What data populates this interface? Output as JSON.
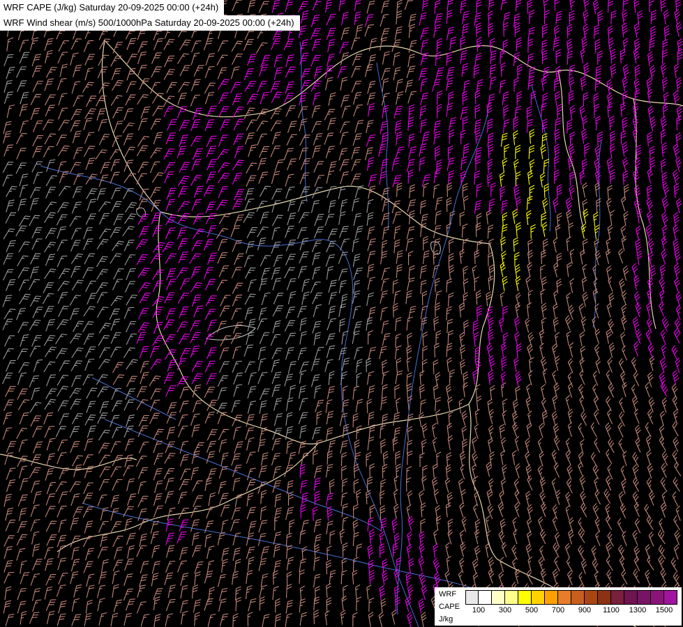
{
  "titles": {
    "line1": "WRF CAPE (J/kg) Saturday 20-09-2025 00:00 (+24h)",
    "line2": "WRF Wind shear (m/s) 500/1000hPa Saturday 20-09-2025 00:00 (+24h)"
  },
  "legend": {
    "model": "WRF",
    "variable": "CAPE",
    "units": "J/kg",
    "tick_labels": [
      "100",
      "300",
      "500",
      "700",
      "900",
      "1100",
      "1300",
      "1500"
    ],
    "colors": [
      "#e8e8e8",
      "#ffffff",
      "#ffffc8",
      "#ffff8c",
      "#ffff00",
      "#ffd200",
      "#ffa000",
      "#e67d28",
      "#c85f1e",
      "#a84614",
      "#8c3214",
      "#78203c",
      "#6e1450",
      "#781464",
      "#8c1478",
      "#a014a0"
    ]
  },
  "map": {
    "background": "#000000",
    "border_color": "#e6d7ae",
    "river_color": "#4a6fd4",
    "lake_color": "#c8c8c8",
    "borders": [
      "M150,58 C185,95 215,135 252,152 C300,174 338,168 372,163 C415,156 448,118 482,93 C520,65 558,58 600,76 C636,91 658,62 700,66 C738,70 760,112 800,102 C838,93 868,130 908,142 C938,150 962,146 979,152",
      "M150,58 C141,110 149,162 170,210 C186,248 208,280 230,304",
      "M230,304 C221,350 236,390 226,432 C216,472 246,502 262,540 C282,582 330,602 380,616 C412,626 432,642 456,636",
      "M230,304 C282,320 332,306 382,296 C422,288 452,276 492,268 C532,262 562,292 602,322 C632,342 672,346 702,350",
      "M702,350 C716,392 706,432 692,470 C682,510 692,548 672,580",
      "M456,636 C492,626 522,612 562,606 C602,600 642,596 672,580",
      "M672,580 C682,622 662,662 682,702 C700,740 692,780 712,802",
      "M82,792 C122,762 162,772 202,752 C242,732 282,742 322,722 C362,702 402,690 432,660 C444,648 452,642 456,636",
      "M908,142 C920,200 900,262 922,322 C936,372 926,422 940,472",
      "M712,802 C742,822 782,832 822,862 C852,882 882,882 912,900",
      "M0,652 C48,660 88,680 128,672 C160,666 176,652 196,660",
      "M800,102 C812,150 800,190 818,230 C832,262 826,300 838,332"
    ],
    "rivers": [
      "M58,238 C118,258 178,252 230,304 C258,332 300,330 340,346 C378,360 420,350 452,344 C482,340 500,362 505,402 C508,442 496,482 490,522 C486,572 496,622 510,662 C526,702 546,742 560,792 C570,832 586,862 600,900",
      "M700,158 C690,210 660,252 650,302 C640,352 622,392 612,442 C602,492 592,542 586,592 C580,642 570,692 576,742 C579,792 566,842 570,882",
      "M150,602 C200,622 250,642 300,662 C350,682 400,702 450,722 C490,736 522,746 546,762",
      "M118,722 C178,742 238,752 298,762 C378,776 458,792 538,812 C598,826 648,832 700,852",
      "M762,122 C772,162 790,202 786,242 C783,272 792,302 788,332",
      "M862,202 C852,252 866,302 856,352 C850,390 858,430 850,470",
      "M132,542 C172,562 212,582 252,602",
      "M540,90 C545,130 560,170 555,210 C550,250 560,290 556,330",
      "M430,60 C435,100 428,140 436,180 C442,215 434,250 440,290"
    ],
    "lakes": [
      "M296,486 C312,470 338,462 366,471 C355,483 328,492 296,486 Z",
      "M196,300 C204,296 210,300 208,310 C202,314 194,308 196,300 Z",
      "M618,348 C628,344 634,352 630,364 C622,368 616,358 618,348 Z"
    ]
  },
  "wind_field": {
    "description": "wind shear barbs 500/1000hPa colored by magnitude",
    "grid_dx": 19.2,
    "grid_dy": 19.15,
    "barb_length": 17,
    "angle_base_deg": -90,
    "swirl1_deg": 16,
    "swirl2_deg": 12,
    "jitter_deg": 16,
    "zone_colors": {
      "s": "#c4867a",
      "g": "#9c9c9c",
      "m": "#ee00ee",
      "y": "#ffff00"
    },
    "zones": [
      "ssssssssssmmmmssmmmmmmmmmm",
      "ssssssssssmmmsssmmmmmmmmmm",
      "gssssssssmmmmsssmmmmmmmmmm",
      "gsssssssmmmmssssmmmmmmmmmm",
      "ssssssmmmsssssmmmmmmmmmmmm",
      "ssssssmmmsssssmmmmmyymmmmm",
      "ggssssmmmsssssmmmmmyymmmmm",
      "gggggsmmmgggggssssmmymssmm",
      "gggggmmmsgggggsssssyysysmm",
      "gggggmmmsgggggsssssyssssmm",
      "gggggmmmsgggggsssssyssssmm",
      "gggggmmmsgggggssssssssssmm",
      "gggggmmmsgggggssssmmssssmm",
      "gggggmmmsgggggssssmmssssmm",
      "ggggssmmggggggssssmmsssssm",
      "sggggsssggggssssssssssssss",
      "ssgggsssssggssssssssssssss",
      "ssssssssssssssssssssssssss",
      "sssssssssssmssssssssssssss",
      "sssssssssssmmsssssssssssss",
      "ssssssmsssssssmmssssssssss",
      "ssssssssssssssmmmsssssssss",
      "ssssssssssssssmmmsssssssss",
      "sssssssssssssssmssssssssss"
    ]
  }
}
